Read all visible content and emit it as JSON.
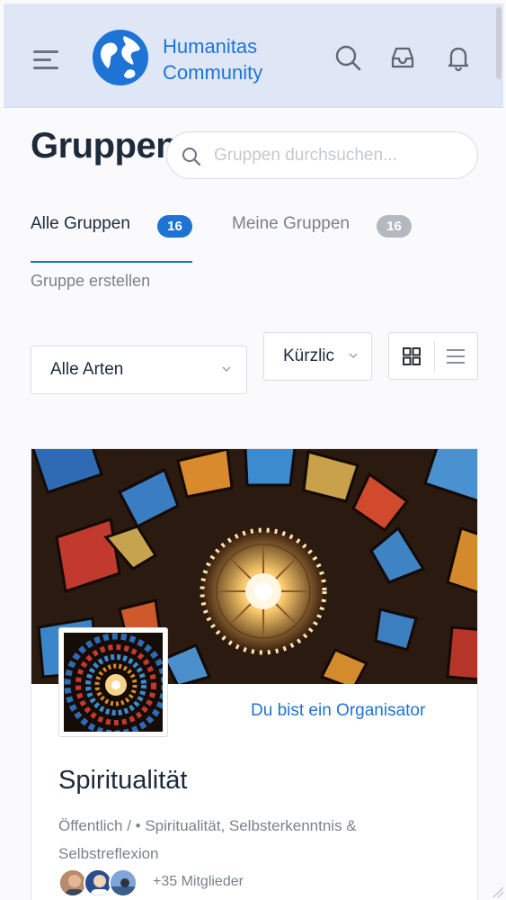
{
  "header": {
    "brand_line1": "Humanitas",
    "brand_line2": "Community",
    "icons": [
      "menu-icon",
      "globe-logo-icon",
      "search-icon",
      "inbox-icon",
      "bell-icon"
    ]
  },
  "page": {
    "title": "Gruppen",
    "search_placeholder": "Gruppen durchsuchen..."
  },
  "tabs": [
    {
      "label": "Alle Gruppen",
      "count": "16",
      "active": true
    },
    {
      "label": "Meine Gruppen",
      "count": "16",
      "active": false
    }
  ],
  "create_link": "Gruppe erstellen",
  "filters": {
    "type_selected": "Alle Arten",
    "order_selected": "Kürzlic"
  },
  "group": {
    "organizer_label": "Du bist ein Organisator",
    "name": "Spiritualität",
    "meta": "Öffentlich / • Spiritualität, Selbsterkenntnis & Selbstreflexion",
    "members": "+35 Mitglieder"
  },
  "colors": {
    "accent": "#1e74d4",
    "header_bg": "#dfe7f7",
    "muted": "#7a828c",
    "badge_grey": "#b4b9c1"
  }
}
